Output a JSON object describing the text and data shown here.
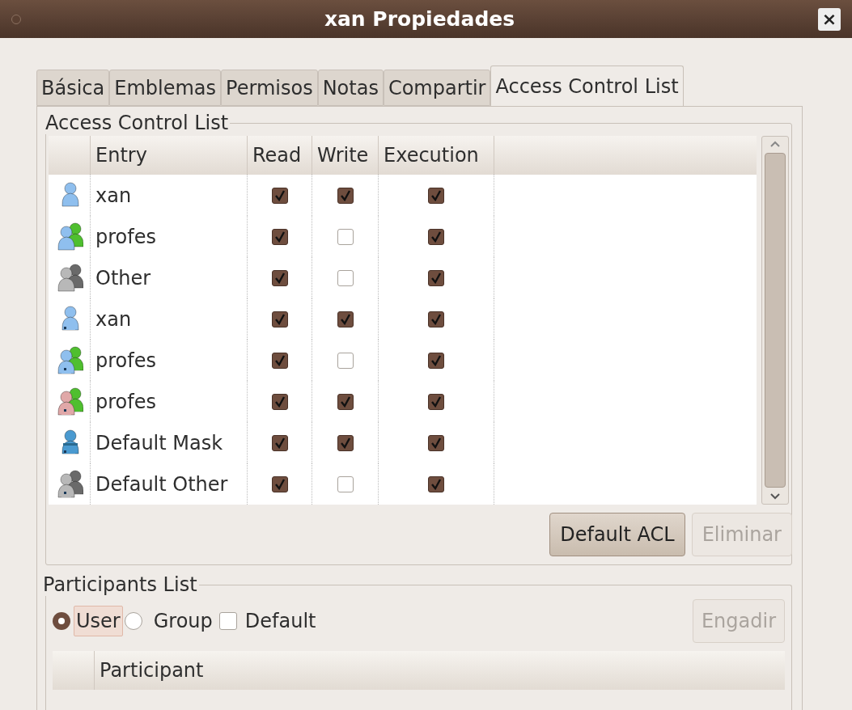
{
  "window": {
    "title": "xan Propiedades",
    "close": "×"
  },
  "tabs": [
    {
      "label": "Básica",
      "selected": false
    },
    {
      "label": "Emblemas",
      "selected": false
    },
    {
      "label": "Permisos",
      "selected": false
    },
    {
      "label": "Notas",
      "selected": false
    },
    {
      "label": "Compartir",
      "selected": false
    },
    {
      "label": "Access Control List",
      "selected": true
    }
  ],
  "acl": {
    "title": "Access Control List",
    "columns": [
      "Entry",
      "Read",
      "Write",
      "Execution"
    ],
    "rows": [
      {
        "kind": "user",
        "default": false,
        "entry": "xan",
        "read": true,
        "write": true,
        "execution": true
      },
      {
        "kind": "group",
        "default": false,
        "entry": "profes",
        "read": true,
        "write": false,
        "execution": true
      },
      {
        "kind": "other",
        "default": false,
        "entry": "Other",
        "read": true,
        "write": false,
        "execution": true
      },
      {
        "kind": "user",
        "default": true,
        "entry": "xan",
        "read": true,
        "write": true,
        "execution": true
      },
      {
        "kind": "group",
        "default": true,
        "entry": "profes",
        "read": true,
        "write": false,
        "execution": true
      },
      {
        "kind": "owner_group",
        "default": true,
        "entry": "profes",
        "read": true,
        "write": true,
        "execution": true
      },
      {
        "kind": "mask",
        "default": true,
        "entry": "Default Mask",
        "read": true,
        "write": true,
        "execution": true
      },
      {
        "kind": "other",
        "default": true,
        "entry": "Default Other",
        "read": true,
        "write": false,
        "execution": true
      }
    ],
    "buttons": [
      {
        "label": "Default ACL",
        "disabled": false
      },
      {
        "label": "Eliminar",
        "disabled": true
      }
    ]
  },
  "participants": {
    "title": "Participants List",
    "options": [
      {
        "kind": "radio",
        "label": "User",
        "selected": true
      },
      {
        "kind": "radio",
        "label": "Group",
        "selected": false
      },
      {
        "kind": "checkbox",
        "label": "Default",
        "checked": false
      }
    ],
    "add_button": {
      "label": "Engadir",
      "disabled": true
    },
    "columns": [
      "Participant"
    ]
  }
}
